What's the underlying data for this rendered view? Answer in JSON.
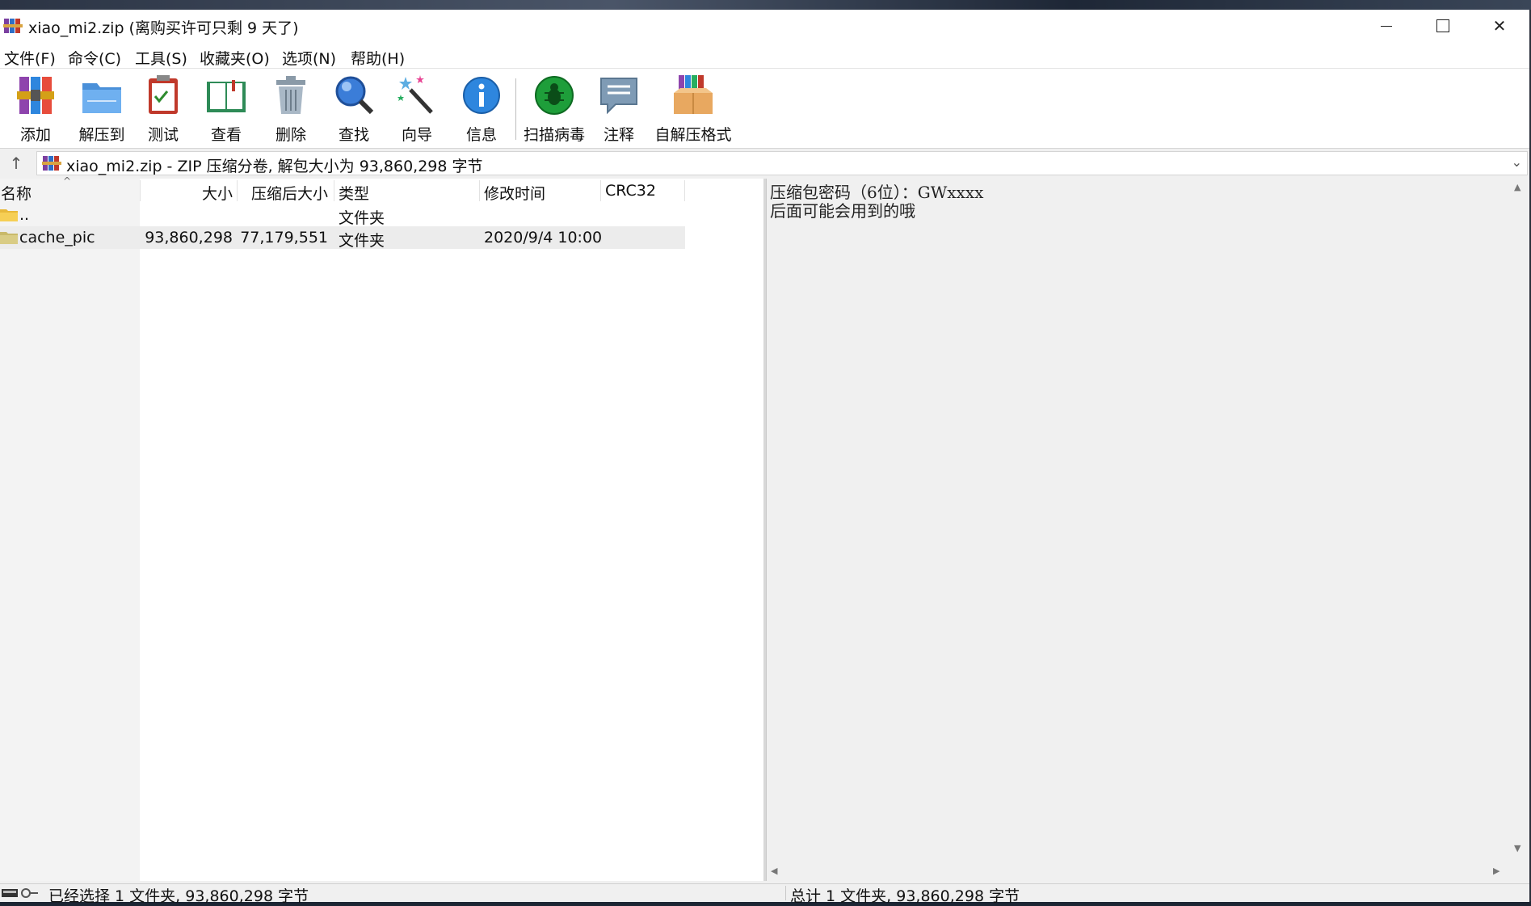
{
  "window": {
    "title": "xiao_mi2.zip (离购买许可只剩 9 天了)"
  },
  "menu": [
    "文件(F)",
    "命令(C)",
    "工具(S)",
    "收藏夹(O)",
    "选项(N)",
    "帮助(H)"
  ],
  "toolbar": {
    "add": "添加",
    "extract_to": "解压到",
    "test": "测试",
    "view": "查看",
    "delete": "删除",
    "find": "查找",
    "wizard": "向导",
    "info": "信息",
    "scan_virus": "扫描病毒",
    "comment": "注释",
    "sfx": "自解压格式"
  },
  "address": {
    "text": "xiao_mi2.zip - ZIP 压缩分卷, 解包大小为 93,860,298 字节"
  },
  "columns": {
    "name": "名称",
    "size": "大小",
    "packed": "压缩后大小",
    "type": "类型",
    "modified": "修改时间",
    "crc": "CRC32"
  },
  "files": [
    {
      "name": "..",
      "size": "",
      "packed": "",
      "type": "文件夹",
      "modified": "",
      "crc": ""
    },
    {
      "name": "cache_pic",
      "size": "93,860,298",
      "packed": "77,179,551",
      "type": "文件夹",
      "modified": "2020/9/4 10:00",
      "crc": ""
    }
  ],
  "comment": {
    "line1": "压缩包密码（6位）：GWxxxx",
    "line2": "后面可能会用到的哦"
  },
  "status": {
    "left": "已经选择 1 文件夹, 93,860,298 字节",
    "right": "总计 1 文件夹, 93,860,298 字节"
  },
  "icons": {
    "app": "winrar-books-icon",
    "folder": "folder-icon",
    "up": "up-arrow-icon"
  }
}
